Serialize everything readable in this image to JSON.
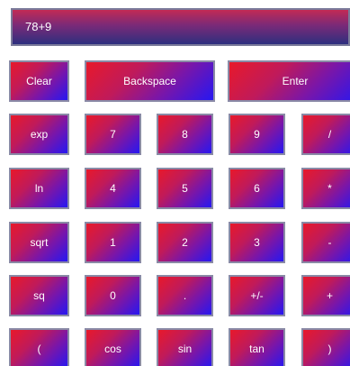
{
  "display": {
    "value": "78+9"
  },
  "buttons": {
    "clear": "Clear",
    "backspace": "Backspace",
    "enter": "Enter",
    "exp": "exp",
    "seven": "7",
    "eight": "8",
    "nine": "9",
    "divide": "/",
    "ln": "ln",
    "four": "4",
    "five": "5",
    "six": "6",
    "multiply": "*",
    "sqrt": "sqrt",
    "one": "1",
    "two": "2",
    "three": "3",
    "minus": "-",
    "sq": "sq",
    "zero": "0",
    "dot": ".",
    "negate": "+/-",
    "plus": "+",
    "lparen": "(",
    "cos": "cos",
    "sin": "sin",
    "tan": "tan",
    "rparen": ")"
  },
  "colors": {
    "button_gradient_start": "#e8192a",
    "button_gradient_end": "#2617f2",
    "display_top": "#c22a55",
    "display_bottom": "#2d2f7e",
    "text": "#ffffff"
  }
}
